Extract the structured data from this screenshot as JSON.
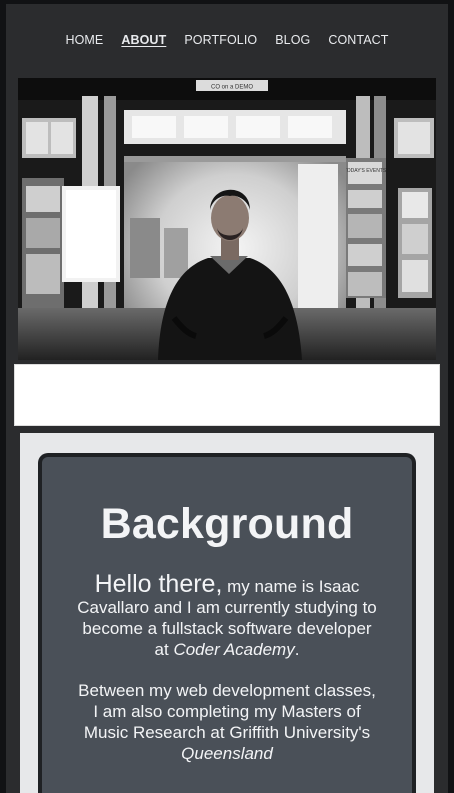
{
  "nav": {
    "items": [
      {
        "label": "HOME",
        "active": false
      },
      {
        "label": "ABOUT",
        "active": true
      },
      {
        "label": "PORTFOLIO",
        "active": false
      },
      {
        "label": "BLOG",
        "active": false
      },
      {
        "label": "CONTACT",
        "active": false
      }
    ]
  },
  "hero": {
    "sign_top": "CO on a DEMO",
    "sign_right": "TODAY'S EVENTS"
  },
  "background": {
    "heading": "Background",
    "greeting": "Hello there,",
    "intro_text": " my name is Isaac Cavallaro and I am currently studying to become a fullstack software developer at ",
    "school": "Coder Academy",
    "intro_end": ".",
    "para2_text": "Between my web development classes, I am also completing my Masters of Music Research at Griffith University's ",
    "para2_em": "Queensland"
  },
  "colors": {
    "page_bg": "#2b2c2e",
    "card_bg": "#4a5058",
    "outer_bg": "#e7e8ea",
    "text": "#f3f4f6"
  }
}
